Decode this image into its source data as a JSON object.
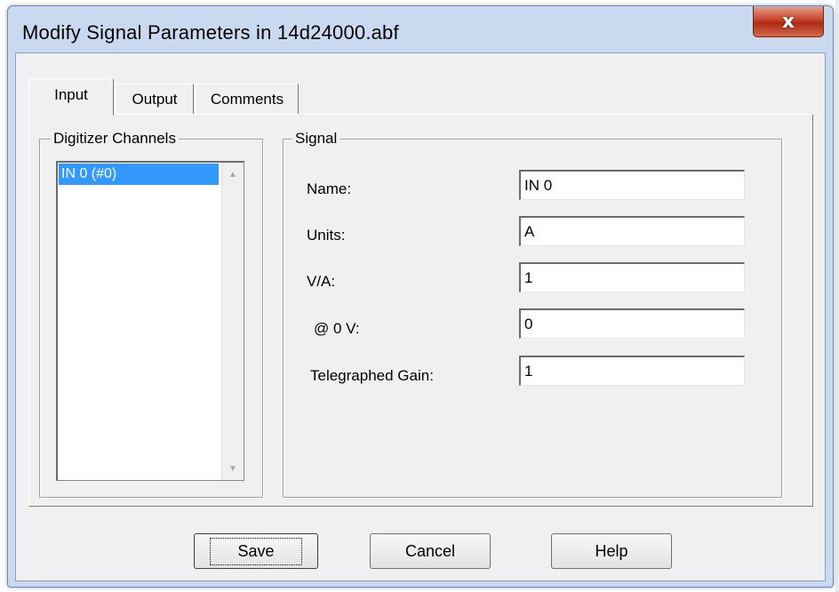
{
  "window": {
    "title": "Modify Signal Parameters in 14d24000.abf",
    "close_glyph": "x"
  },
  "tabs": [
    {
      "label": "Input",
      "active": true
    },
    {
      "label": "Output",
      "active": false
    },
    {
      "label": "Comments",
      "active": false
    }
  ],
  "channels": {
    "group_label": "Digitizer Channels",
    "items": [
      {
        "label": "IN 0 (#0)",
        "selected": true
      }
    ]
  },
  "signal": {
    "group_label": "Signal",
    "fields": [
      {
        "label": "Name:",
        "value": "IN 0"
      },
      {
        "label": "Units:",
        "value": "A"
      },
      {
        "label": "V/A:",
        "value": "1"
      },
      {
        "label": "@ 0 V:",
        "value": "0"
      },
      {
        "label": "Telegraphed Gain:",
        "value": "1"
      }
    ]
  },
  "buttons": {
    "save": "Save",
    "cancel": "Cancel",
    "help": "Help"
  },
  "colors": {
    "selection": "#3399ff",
    "close_button": "#c7442a",
    "frame": "#c9daf0"
  }
}
